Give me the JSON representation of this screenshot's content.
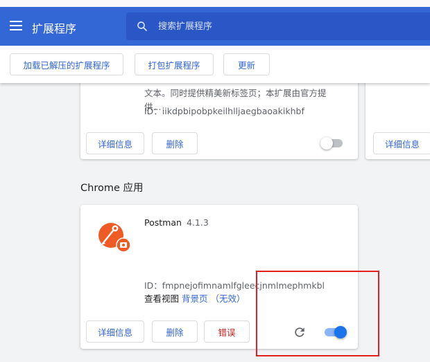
{
  "header": {
    "title": "扩展程序",
    "search_placeholder": "搜索扩展程序"
  },
  "toolbar": {
    "load_unpacked": "加载已解压的扩展程序",
    "pack": "打包扩展程序",
    "update": "更新"
  },
  "card1": {
    "desc_line1": "文本。同时提供精美新标签页；本扩展由官方提",
    "desc_line2": "供...",
    "id_text": "ID：iikdpbipobpkeilhlljaegbaoakikhbf",
    "details": "详细信息",
    "remove": "删除",
    "enabled": false
  },
  "card2": {
    "details": "详细信息"
  },
  "section": {
    "chrome_apps": "Chrome 应用"
  },
  "postman": {
    "name": "Postman",
    "version": "4.1.3",
    "id_text": "ID：fmpnejofimnamlfgleecjnmlmephmkbl",
    "inspect_label": "查看视图",
    "background_page": "背景页",
    "inactive": "（无效）",
    "details": "详细信息",
    "remove": "删除",
    "errors": "错误",
    "enabled": true
  },
  "colors": {
    "header_bg": "#3367d6",
    "accent": "#1a73e8",
    "error": "#c5221f",
    "highlight": "#e51f1f",
    "postman_orange": "#ef5b25"
  }
}
